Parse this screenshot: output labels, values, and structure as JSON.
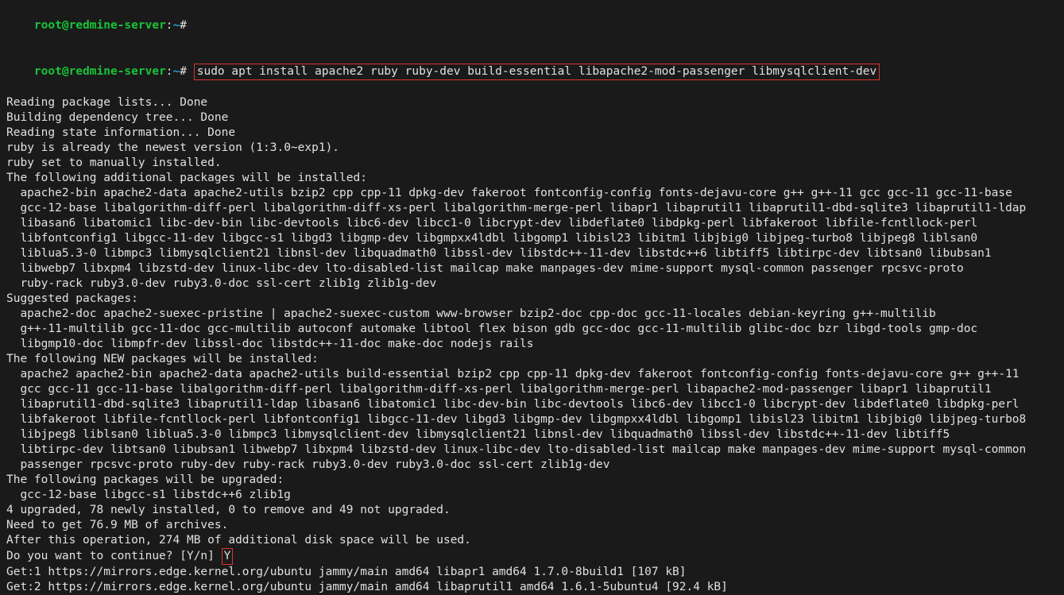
{
  "prompt": {
    "user": "root",
    "at": "@",
    "host": "redmine-server",
    "colon": ":",
    "path": "~",
    "hash": "#"
  },
  "command": "sudo apt install apache2 ruby ruby-dev build-essential libapache2-mod-passenger libmysqlclient-dev",
  "out": {
    "l1": "Reading package lists... Done",
    "l2": "Building dependency tree... Done",
    "l3": "Reading state information... Done",
    "l4": "ruby is already the newest version (1:3.0~exp1).",
    "l5": "ruby set to manually installed.",
    "l6": "The following additional packages will be installed:",
    "add1": "apache2-bin apache2-data apache2-utils bzip2 cpp cpp-11 dpkg-dev fakeroot fontconfig-config fonts-dejavu-core g++ g++-11 gcc gcc-11 gcc-11-base",
    "add2": "gcc-12-base libalgorithm-diff-perl libalgorithm-diff-xs-perl libalgorithm-merge-perl libapr1 libaprutil1 libaprutil1-dbd-sqlite3 libaprutil1-ldap",
    "add3": "libasan6 libatomic1 libc-dev-bin libc-devtools libc6-dev libcc1-0 libcrypt-dev libdeflate0 libdpkg-perl libfakeroot libfile-fcntllock-perl",
    "add4": "libfontconfig1 libgcc-11-dev libgcc-s1 libgd3 libgmp-dev libgmpxx4ldbl libgomp1 libisl23 libitm1 libjbig0 libjpeg-turbo8 libjpeg8 liblsan0",
    "add5": "liblua5.3-0 libmpc3 libmysqlclient21 libnsl-dev libquadmath0 libssl-dev libstdc++-11-dev libstdc++6 libtiff5 libtirpc-dev libtsan0 libubsan1",
    "add6": "libwebp7 libxpm4 libzstd-dev linux-libc-dev lto-disabled-list mailcap make manpages-dev mime-support mysql-common passenger rpcsvc-proto",
    "add7": "ruby-rack ruby3.0-dev ruby3.0-doc ssl-cert zlib1g zlib1g-dev",
    "l7": "Suggested packages:",
    "sug1": "apache2-doc apache2-suexec-pristine | apache2-suexec-custom www-browser bzip2-doc cpp-doc gcc-11-locales debian-keyring g++-multilib",
    "sug2": "g++-11-multilib gcc-11-doc gcc-multilib autoconf automake libtool flex bison gdb gcc-doc gcc-11-multilib glibc-doc bzr libgd-tools gmp-doc",
    "sug3": "libgmp10-doc libmpfr-dev libssl-doc libstdc++-11-doc make-doc nodejs rails",
    "l8": "The following NEW packages will be installed:",
    "new1": "apache2 apache2-bin apache2-data apache2-utils build-essential bzip2 cpp cpp-11 dpkg-dev fakeroot fontconfig-config fonts-dejavu-core g++ g++-11",
    "new2": "gcc gcc-11 gcc-11-base libalgorithm-diff-perl libalgorithm-diff-xs-perl libalgorithm-merge-perl libapache2-mod-passenger libapr1 libaprutil1",
    "new3": "libaprutil1-dbd-sqlite3 libaprutil1-ldap libasan6 libatomic1 libc-dev-bin libc-devtools libc6-dev libcc1-0 libcrypt-dev libdeflate0 libdpkg-perl",
    "new4": "libfakeroot libfile-fcntllock-perl libfontconfig1 libgcc-11-dev libgd3 libgmp-dev libgmpxx4ldbl libgomp1 libisl23 libitm1 libjbig0 libjpeg-turbo8",
    "new5": "libjpeg8 liblsan0 liblua5.3-0 libmpc3 libmysqlclient-dev libmysqlclient21 libnsl-dev libquadmath0 libssl-dev libstdc++-11-dev libtiff5",
    "new6": "libtirpc-dev libtsan0 libubsan1 libwebp7 libxpm4 libzstd-dev linux-libc-dev lto-disabled-list mailcap make manpages-dev mime-support mysql-common",
    "new7": "passenger rpcsvc-proto ruby-dev ruby-rack ruby3.0-dev ruby3.0-doc ssl-cert zlib1g-dev",
    "l9": "The following packages will be upgraded:",
    "upg1": "gcc-12-base libgcc-s1 libstdc++6 zlib1g",
    "l10": "4 upgraded, 78 newly installed, 0 to remove and 49 not upgraded.",
    "l11": "Need to get 76.9 MB of archives.",
    "l12": "After this operation, 274 MB of additional disk space will be used.",
    "l13a": "Do you want to continue? [Y/n] ",
    "l13b": "Y",
    "l14": "Get:1 https://mirrors.edge.kernel.org/ubuntu jammy/main amd64 libapr1 amd64 1.7.0-8build1 [107 kB]",
    "l15": "Get:2 https://mirrors.edge.kernel.org/ubuntu jammy/main amd64 libaprutil1 amd64 1.6.1-5ubuntu4 [92.4 kB]"
  }
}
